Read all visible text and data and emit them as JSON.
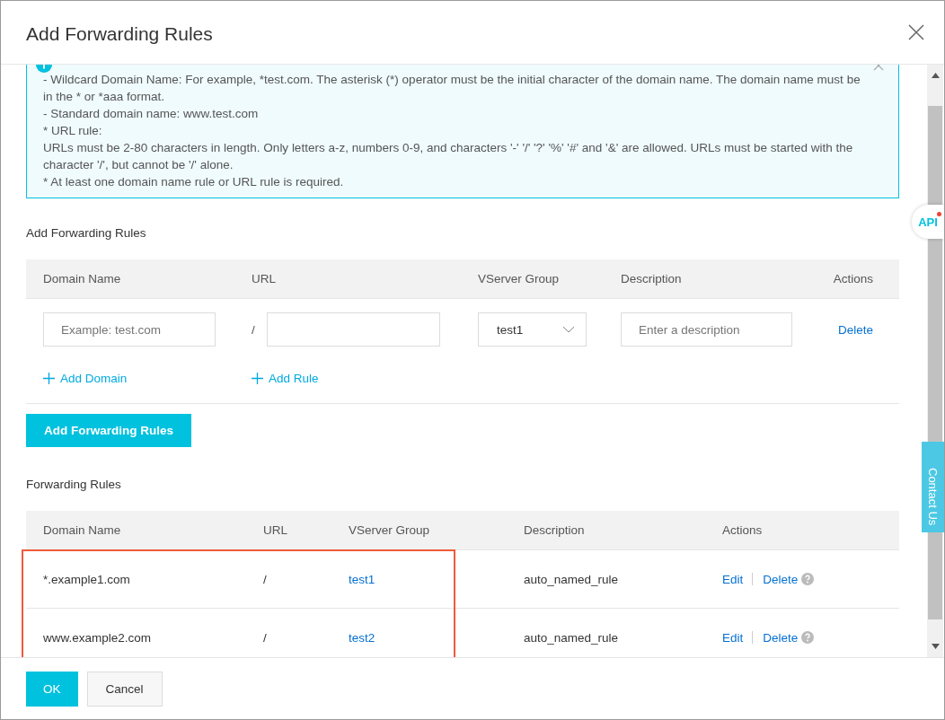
{
  "dialog": {
    "title": "Add Forwarding Rules"
  },
  "notice": {
    "lines": [
      "- Wildcard Domain Name: For example, *test.com. The asterisk (*) operator must be the initial character of the domain name. The domain name must be in the * or *aaa format.",
      "- Standard domain name: www.test.com",
      "* URL rule:",
      "URLs must be 2-80 characters in length. Only letters a-z, numbers 0-9, and characters '-' '/' '?' '%' '#' and '&' are allowed. URLs must be started with the character '/', but cannot be '/' alone.",
      "* At least one domain name rule or URL rule is required."
    ]
  },
  "add_section": {
    "heading": "Add Forwarding Rules",
    "columns": [
      "Domain Name",
      "URL",
      "VServer Group",
      "Description",
      "Actions"
    ],
    "row": {
      "domain_placeholder": "Example: test.com",
      "slash": "/",
      "vserver_group": "test1",
      "description_placeholder": "Enter a description",
      "action": "Delete"
    },
    "add_domain": "Add Domain",
    "add_rule": "Add Rule",
    "submit": "Add Forwarding Rules"
  },
  "rules_section": {
    "heading": "Forwarding Rules",
    "columns": [
      "Domain Name",
      "URL",
      "VServer Group",
      "Description",
      "Actions"
    ],
    "rows": [
      {
        "domain": "*.example1.com",
        "url": "/",
        "vserver_group": "test1",
        "description": "auto_named_rule",
        "actions": [
          "Edit",
          "Delete"
        ],
        "highlighted": true
      },
      {
        "domain": "www.example2.com",
        "url": "/",
        "vserver_group": "test2",
        "description": "auto_named_rule",
        "actions": [
          "Edit",
          "Delete"
        ],
        "highlighted": true
      }
    ]
  },
  "side_widgets": {
    "api": "API",
    "contact": "Contact Us"
  },
  "footer": {
    "buttons": [
      {
        "label": "OK",
        "kind": "primary"
      },
      {
        "label": "Cancel",
        "kind": "secondary"
      }
    ]
  }
}
